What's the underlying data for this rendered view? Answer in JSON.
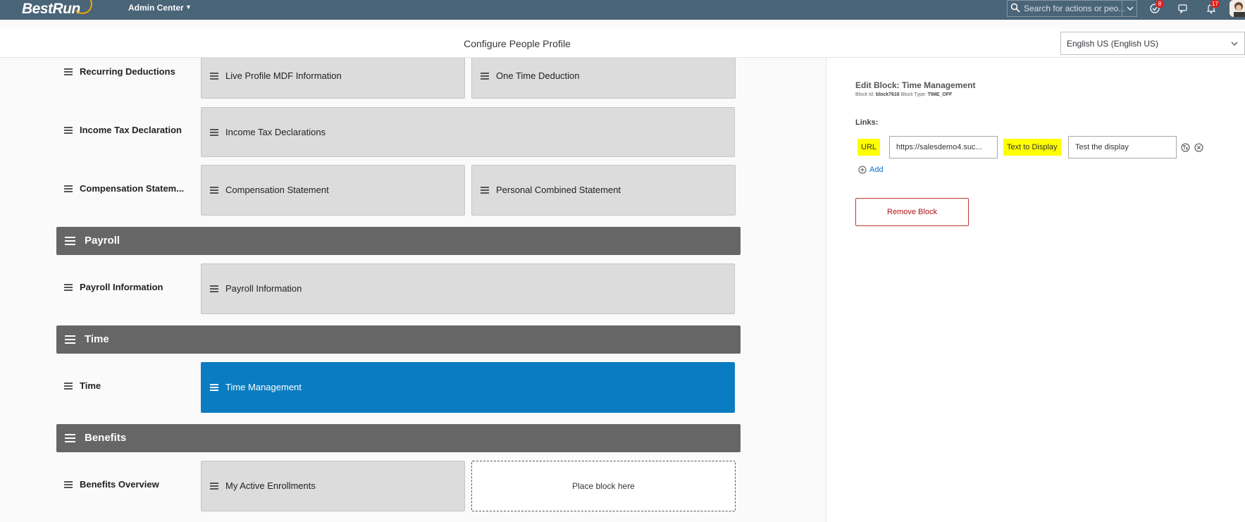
{
  "topbar": {
    "logo": "BestRun",
    "menu_label": "Admin Center",
    "search_placeholder": "Search for actions or peo...",
    "todo_badge": "8",
    "notif_badge": "17"
  },
  "subheader": {
    "title": "Configure People Profile",
    "language": "English US (English US)"
  },
  "rows": [
    {
      "label": "Recurring Deductions",
      "blocks": [
        "Live Profile MDF Information",
        "One Time Deduction"
      ]
    },
    {
      "label": "Income Tax Declaration",
      "blocks": [
        "Income Tax Declarations"
      ]
    },
    {
      "label": "Compensation Statem...",
      "blocks": [
        "Compensation Statement",
        "Personal Combined Statement"
      ]
    },
    {
      "label": "Payroll Information",
      "blocks": [
        "Payroll Information"
      ]
    },
    {
      "label": "Time",
      "blocks": [
        "Time Management"
      ]
    },
    {
      "label": "Benefits Overview",
      "blocks": [
        "My Active Enrollments"
      ],
      "placeholder": "Place block here"
    }
  ],
  "sections": [
    "Payroll",
    "Time",
    "Benefits"
  ],
  "edit_panel": {
    "title": "Edit Block: Time Management",
    "block_id_label": "Block Id:",
    "block_id": "block7616",
    "block_type_label": "Block Type:",
    "block_type": "TIME_OFF",
    "links_label": "Links:",
    "url_label": "URL",
    "url_value": "https://salesdemo4.suc...",
    "text_label": "Text to Display",
    "text_value": "Test the display",
    "add_label": "Add",
    "remove_label": "Remove Block"
  },
  "colors": {
    "header_bg": "#4a6478",
    "section_bg": "#666666",
    "selected_block": "#0a7cc1",
    "highlight": "#ffff00"
  }
}
